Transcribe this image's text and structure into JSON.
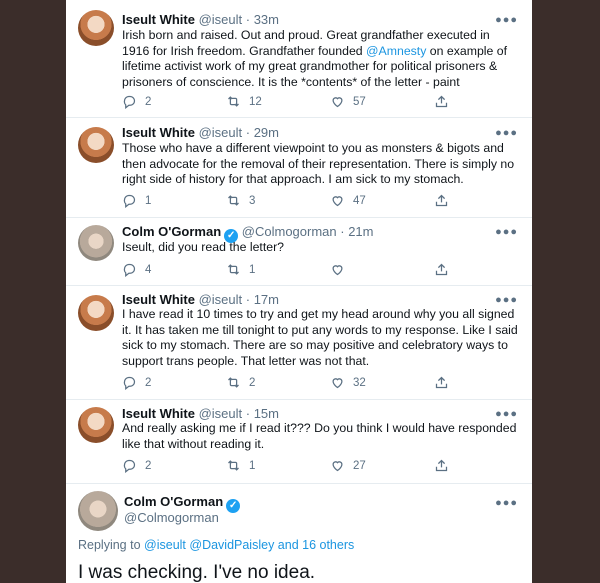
{
  "tweets": [
    {
      "name": "Iseult White",
      "handle": "@iseult",
      "time": "33m",
      "verified": false,
      "text_parts": [
        "Irish born and raised. Out and proud. Great grandfather executed in 1916 for Irish freedom. Grandfather founded ",
        "@Amnesty",
        " on example of lifetime activist work of my great grandmother for political prisoners & prisoners of conscience. It is the *contents* of the letter - paint"
      ],
      "replies": "2",
      "retweets": "12",
      "likes": "57"
    },
    {
      "name": "Iseult White",
      "handle": "@iseult",
      "time": "29m",
      "verified": false,
      "text": "Those who have a different viewpoint to you as monsters & bigots and then advocate for the removal of their representation. There is simply no right side of history for that approach. I am sick to my stomach.",
      "replies": "1",
      "retweets": "3",
      "likes": "47"
    },
    {
      "name": "Colm O'Gorman",
      "handle": "@Colmogorman",
      "time": "21m",
      "verified": true,
      "text": "Iseult, did you read the letter?",
      "replies": "4",
      "retweets": "1",
      "likes": ""
    },
    {
      "name": "Iseult White",
      "handle": "@iseult",
      "time": "17m",
      "verified": false,
      "text": "I have read it 10 times to try and get my head around why you all signed it. It has taken me till tonight to put any words to my response. Like I said sick to my stomach. There are so may positive and celebratory ways to support trans people. That letter was not that.",
      "replies": "2",
      "retweets": "2",
      "likes": "32"
    },
    {
      "name": "Iseult White",
      "handle": "@iseult",
      "time": "15m",
      "verified": false,
      "text": "And really asking me if I read it??? Do you think I would have responded like that without reading it.",
      "replies": "2",
      "retweets": "1",
      "likes": "27"
    }
  ],
  "focus": {
    "name": "Colm O'Gorman",
    "handle": "@Colmogorman",
    "verified": true,
    "replying_prefix": "Replying to",
    "replying_to": "@iseult @DavidPaisley and 16 others",
    "text": "I was checking. I've no idea."
  },
  "icons": {
    "more": "more-icon",
    "reply": "reply-icon",
    "retweet": "retweet-icon",
    "like": "like-icon",
    "share": "share-icon",
    "verified": "verified-icon"
  },
  "colors": {
    "link": "#1b95e0",
    "muted": "#5b7083",
    "verified": "#1da1f2",
    "backdrop": "#3b2d2a"
  }
}
